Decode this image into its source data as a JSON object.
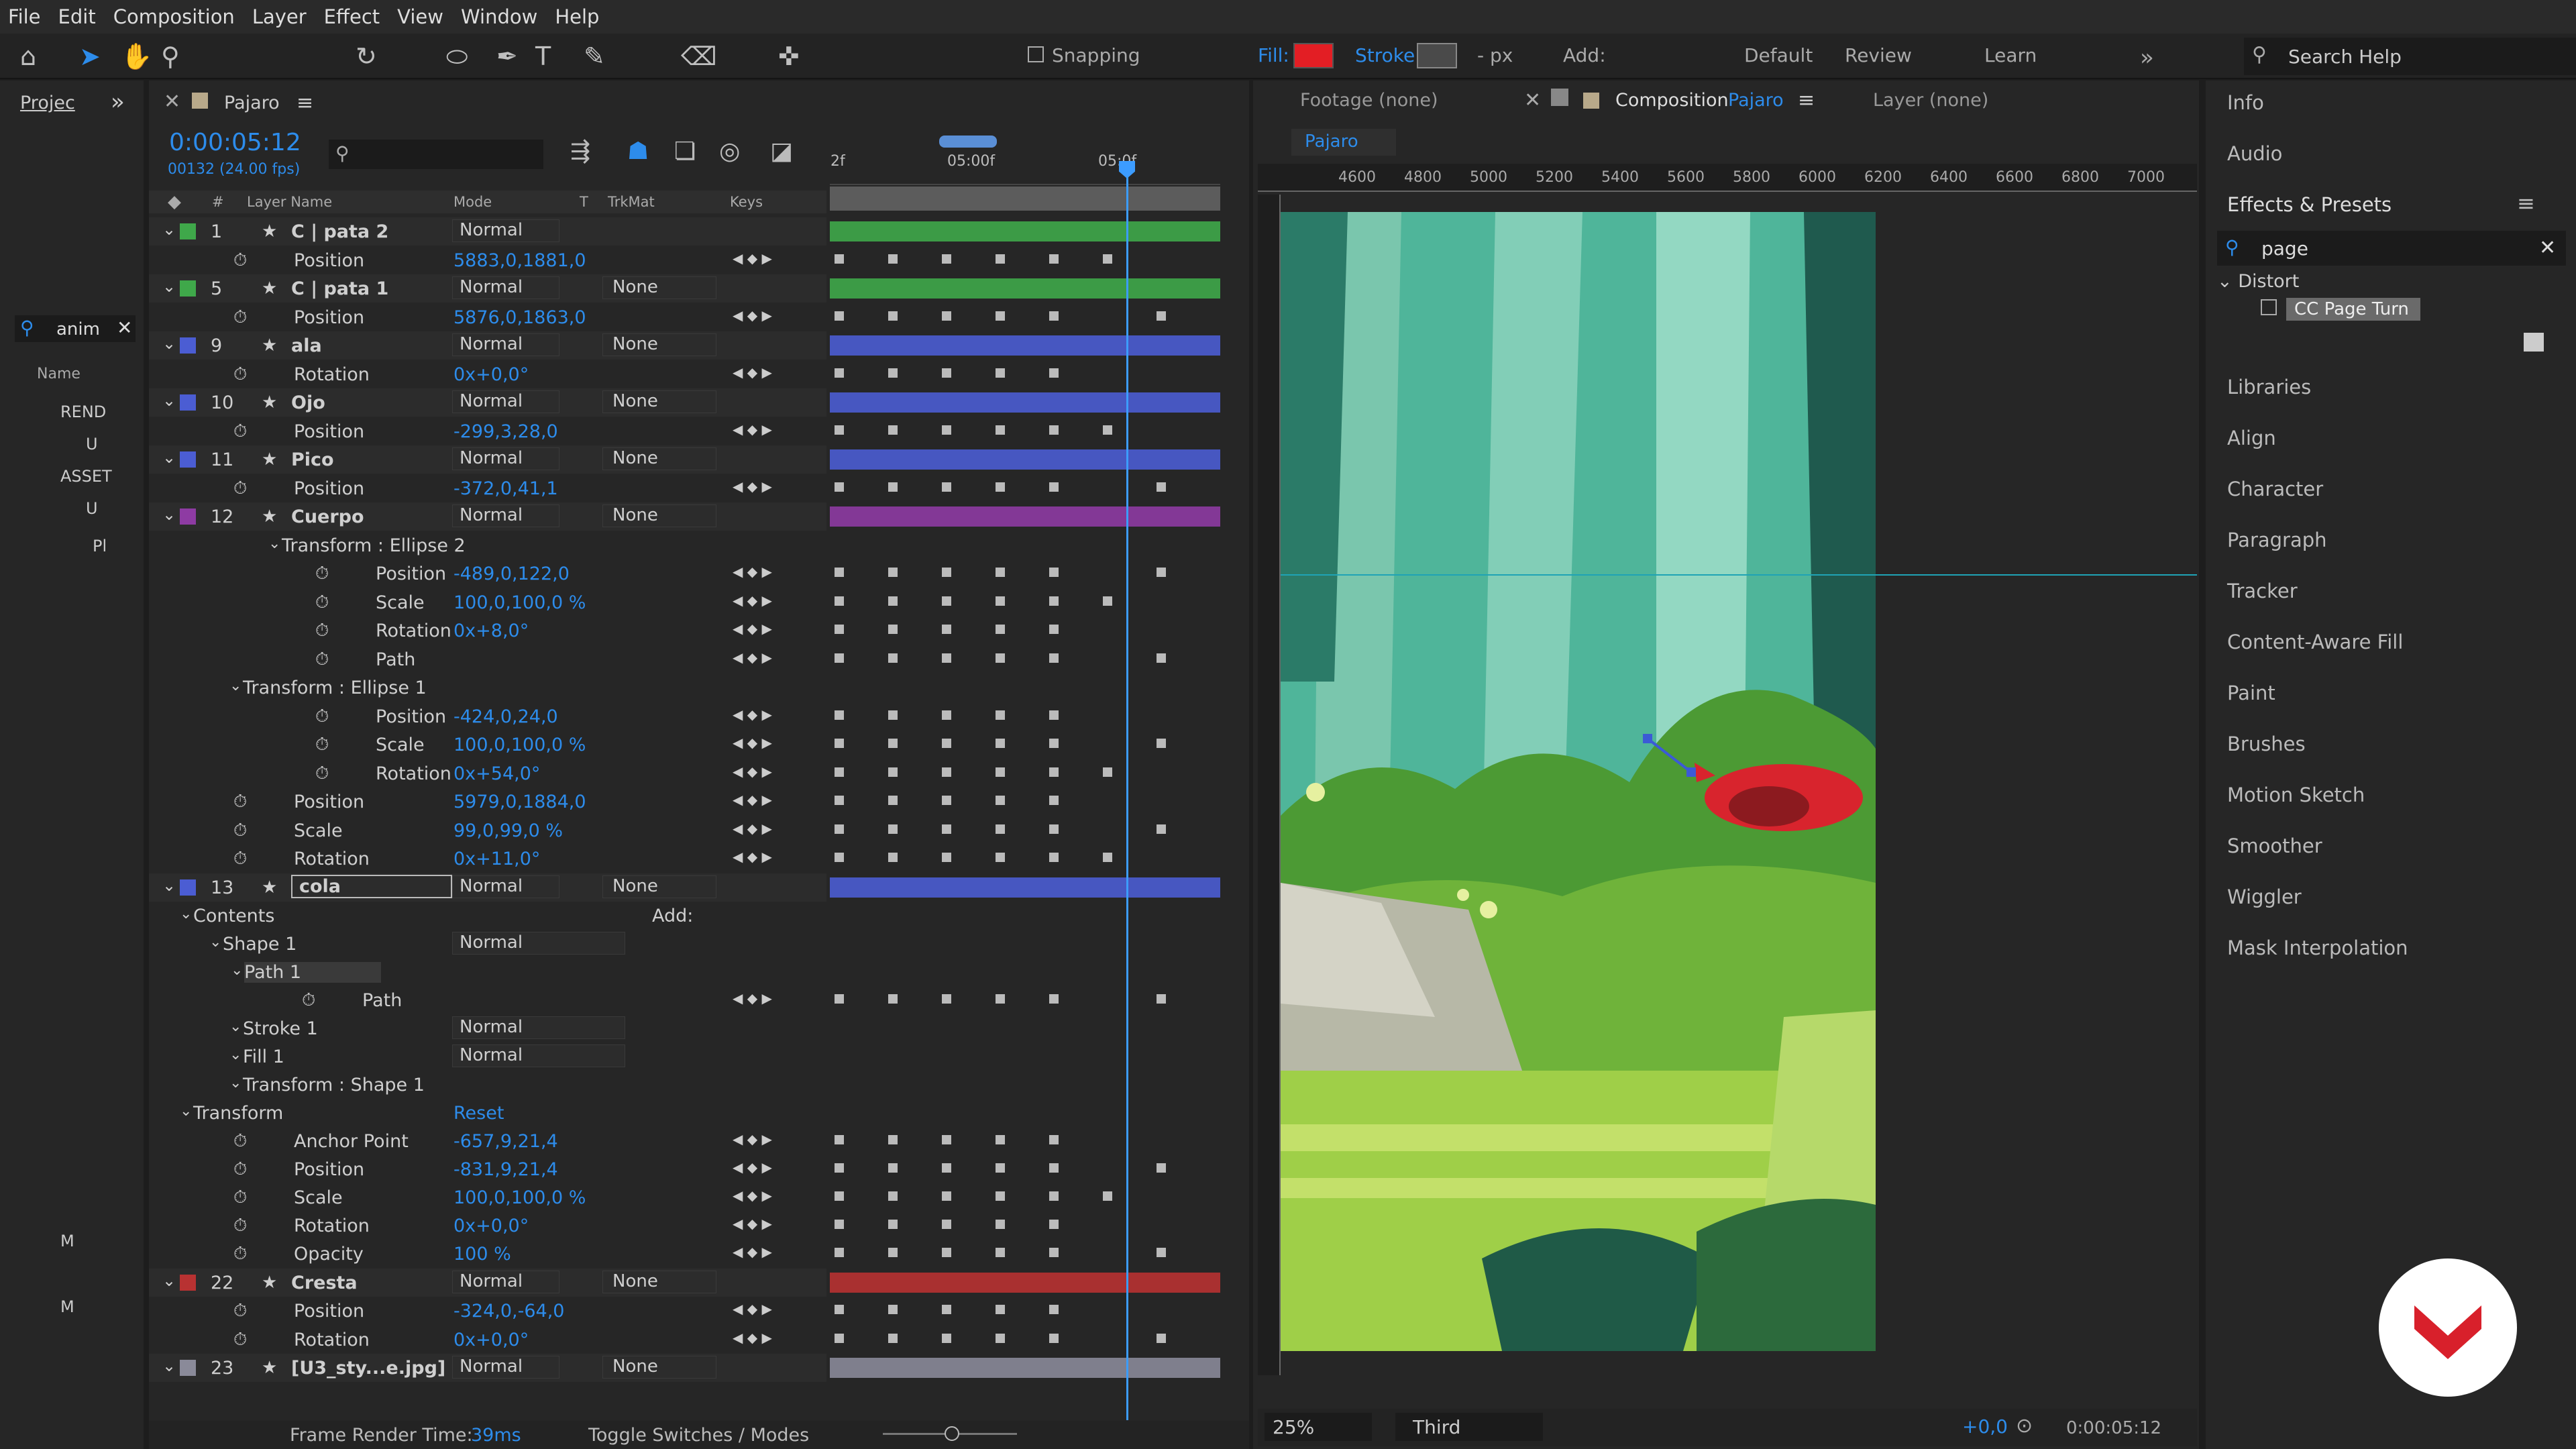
{
  "menu": [
    "File",
    "Edit",
    "Composition",
    "Layer",
    "Effect",
    "View",
    "Window",
    "Help"
  ],
  "toolbar": {
    "snapping": "Snapping",
    "fill": "Fill:",
    "stroke": "Stroke:",
    "px": "- px",
    "add": "Add:",
    "ws": [
      "Default",
      "Review",
      "Learn"
    ],
    "search": "Search Help"
  },
  "project": {
    "tab": "Projec",
    "search": "anim",
    "cols": "Name",
    "items": [
      "REND",
      "U",
      "ASSET",
      "U",
      "Pl",
      "M",
      "M"
    ]
  },
  "timeline": {
    "tab": "Pajaro",
    "time": "0:00:05:12",
    "frames": "00132 (24.00 fps)",
    "ruler": [
      "2f",
      "05:00f",
      "05:0f"
    ],
    "cols": [
      "#",
      "Layer Name",
      "Mode",
      "T",
      "TrkMat",
      "Keys"
    ],
    "footer": "Frame Render Time:",
    "rt": "39ms",
    "toggle": "Toggle Switches / Modes"
  },
  "layers": [
    {
      "n": "1",
      "name": "C | pata 2",
      "mode": "Normal",
      "trk": "",
      "color": "#3fa84a"
    },
    {
      "p": "Position",
      "v": "5883,0,1881,0"
    },
    {
      "n": "5",
      "name": "C | pata 1",
      "mode": "Normal",
      "trk": "None",
      "color": "#3fa84a"
    },
    {
      "p": "Position",
      "v": "5876,0,1863,0"
    },
    {
      "n": "9",
      "name": "ala",
      "mode": "Normal",
      "trk": "None",
      "color": "#4b5dd3"
    },
    {
      "p": "Rotation",
      "v": "0x+0,0°"
    },
    {
      "n": "10",
      "name": "Ojo",
      "mode": "Normal",
      "trk": "None",
      "color": "#4b5dd3"
    },
    {
      "p": "Position",
      "v": "-299,3,28,0"
    },
    {
      "n": "11",
      "name": "Pico",
      "mode": "Normal",
      "trk": "None",
      "color": "#4b5dd3"
    },
    {
      "p": "Position",
      "v": "-372,0,41,1"
    },
    {
      "n": "12",
      "name": "Cuerpo",
      "mode": "Normal",
      "trk": "None",
      "color": "#8e3ba3"
    },
    {
      "g": "Transform : Ellipse 2"
    },
    {
      "p": "Position",
      "v": "-489,0,122,0",
      "d": 1
    },
    {
      "p": "Scale",
      "v": "100,0,100,0 %",
      "d": 1
    },
    {
      "p": "Rotation",
      "v": "0x+8,0°",
      "d": 1
    },
    {
      "p": "Path",
      "v": "",
      "d": 1
    },
    {
      "g": "Transform : Ellipse 1"
    },
    {
      "p": "Position",
      "v": "-424,0,24,0",
      "d": 1
    },
    {
      "p": "Scale",
      "v": "100,0,100,0 %",
      "d": 1
    },
    {
      "p": "Rotation",
      "v": "0x+54,0°",
      "d": 1
    },
    {
      "p": "Position",
      "v": "5979,0,1884,0"
    },
    {
      "p": "Scale",
      "v": "99,0,99,0 %"
    },
    {
      "p": "Rotation",
      "v": "0x+11,0°"
    },
    {
      "n": "13",
      "name": "cola",
      "mode": "Normal",
      "trk": "None",
      "color": "#4b5dd3"
    },
    {
      "g": "Contents",
      "add": "Add:"
    },
    {
      "g": "Shape 1",
      "m": "Normal"
    },
    {
      "g": "Path 1"
    },
    {
      "p": "Path",
      "v": "",
      "d": 2
    },
    {
      "g": "Stroke 1",
      "m": "Normal"
    },
    {
      "g": "Fill 1",
      "m": "Normal"
    },
    {
      "g": "Transform : Shape 1"
    },
    {
      "g": "Transform",
      "v": "Reset"
    },
    {
      "p": "Anchor Point",
      "v": "-657,9,21,4"
    },
    {
      "p": "Position",
      "v": "-831,9,21,4"
    },
    {
      "p": "Scale",
      "v": "100,0,100,0 %"
    },
    {
      "p": "Rotation",
      "v": "0x+0,0°"
    },
    {
      "p": "Opacity",
      "v": "100 %"
    },
    {
      "n": "22",
      "name": "Cresta",
      "mode": "Normal",
      "trk": "None",
      "color": "#b83232"
    },
    {
      "p": "Position",
      "v": "-324,0,-64,0"
    },
    {
      "p": "Rotation",
      "v": "0x+0,0°"
    },
    {
      "n": "23",
      "name": "[U3_sty...e.jpg]",
      "mode": "Normal",
      "trk": "None",
      "color": "#8a8a99"
    }
  ],
  "viewer": {
    "footage": "Footage (none)",
    "comp": "Composition",
    "compname": "Pajaro",
    "layer": "Layer (none)",
    "crumb": "Pajaro",
    "ruler": [
      "4600",
      "4800",
      "5000",
      "5200",
      "5400",
      "5600",
      "5800",
      "6000",
      "6200",
      "6400",
      "6600",
      "6800",
      "7000"
    ],
    "zoom": "25%",
    "res": "Third",
    "exposure": "+0,0",
    "tc": "0:00:05:12"
  },
  "right": {
    "top": [
      "Info",
      "Audio"
    ],
    "effects": "Effects & Presets",
    "search": "page",
    "cat": "Distort",
    "fx": "CC Page Turn",
    "items": [
      "Libraries",
      "Align",
      "Character",
      "Paragraph",
      "Tracker",
      "Content-Aware Fill",
      "Paint",
      "Brushes",
      "Motion Sketch",
      "Smoother",
      "Wiggler",
      "Mask Interpolation"
    ]
  },
  "colors": {
    "accent": "#2d8ceb",
    "fill": "#e31e24",
    "bird": "#d8242d"
  }
}
